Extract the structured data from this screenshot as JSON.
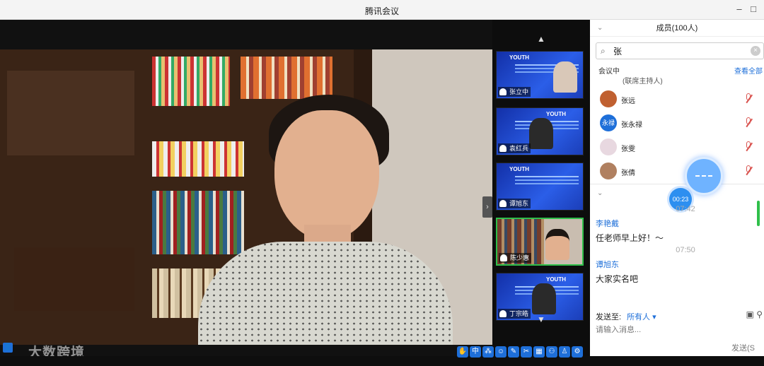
{
  "window": {
    "title": "腾讯会议"
  },
  "stage": {
    "speaker_name": "陈少惠",
    "watermark": "大数跨境"
  },
  "thumbs": [
    {
      "name": "张立中",
      "yt": "YOUTH"
    },
    {
      "name": "袁红兵",
      "yt": "YOUTH"
    },
    {
      "name": "谭旭东",
      "yt": "YOUTH"
    },
    {
      "name": "陈少惠",
      "yt": ""
    },
    {
      "name": "丁宗皓",
      "yt": "YOUTH"
    }
  ],
  "panel": {
    "header": "成员(100人)",
    "search": {
      "value": "张",
      "placeholder": ""
    },
    "section_label": "会议中",
    "view_all": "查看全部",
    "host_note": "(联席主持人)",
    "members": [
      {
        "name": "张远",
        "avatar": ""
      },
      {
        "name": "张永禄",
        "avatar": "永禄"
      },
      {
        "name": "张雯",
        "avatar": ""
      },
      {
        "name": "张倩",
        "avatar": ""
      }
    ],
    "timer": "00:23",
    "chat": [
      {
        "time": "07:42",
        "sender": "李艳戴",
        "text": "任老师早上好！～"
      },
      {
        "time": "07:50",
        "sender": "谭旭东",
        "text": "大家实名吧"
      }
    ],
    "send_to_label": "发送至:",
    "send_to_value": "所有人 ▾",
    "input_placeholder": "请输入消息...",
    "send_label": "发送(S"
  },
  "colors": {
    "accent": "#1e6fd9",
    "active_border": "#2fbf4a",
    "mute": "#d9534f"
  }
}
